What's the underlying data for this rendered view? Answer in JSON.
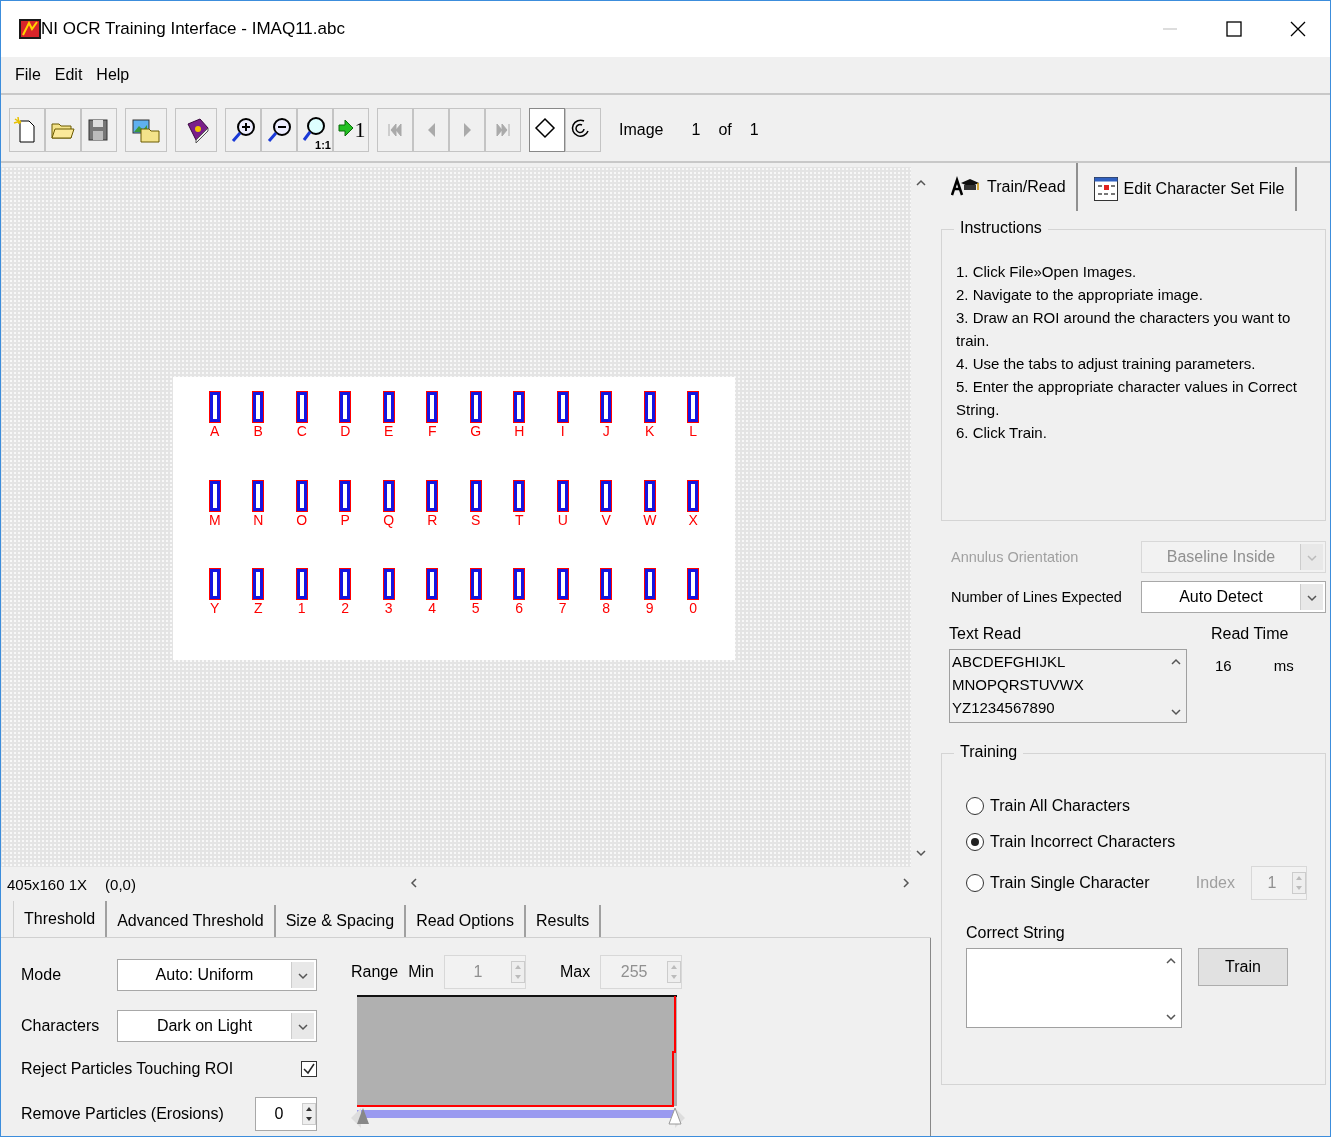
{
  "window": {
    "title": "NI OCR Training Interface - IMAQ11.abc"
  },
  "menu": [
    {
      "label": "File"
    },
    {
      "label": "Edit"
    },
    {
      "label": "Help"
    }
  ],
  "toolbar": {
    "groups": [
      [
        {
          "kind": "new"
        },
        {
          "kind": "open"
        },
        {
          "kind": "save"
        }
      ],
      [
        {
          "kind": "open-images"
        }
      ],
      [
        {
          "kind": "help"
        }
      ],
      [
        {
          "kind": "zoom-in"
        },
        {
          "kind": "zoom-out"
        },
        {
          "kind": "zoom-actual",
          "label": "1:1"
        },
        {
          "kind": "zoom-fit",
          "label": "1"
        }
      ],
      [
        {
          "kind": "first",
          "disabled": true
        },
        {
          "kind": "prev",
          "disabled": true
        },
        {
          "kind": "next",
          "disabled": true
        },
        {
          "kind": "last",
          "disabled": true
        }
      ],
      [
        {
          "kind": "rect-tool",
          "selected": true
        },
        {
          "kind": "annulus-tool",
          "selected": false
        }
      ]
    ],
    "image_label": "Image",
    "image_index": "1",
    "of_label": "of",
    "image_count": "1"
  },
  "image_view": {
    "rows": [
      [
        "A",
        "B",
        "C",
        "D",
        "E",
        "F",
        "G",
        "H",
        "I",
        "J",
        "K",
        "L"
      ],
      [
        "M",
        "N",
        "O",
        "P",
        "Q",
        "R",
        "S",
        "T",
        "U",
        "V",
        "W",
        "X"
      ],
      [
        "Y",
        "Z",
        "1",
        "2",
        "3",
        "4",
        "5",
        "6",
        "7",
        "8",
        "9",
        "0"
      ]
    ]
  },
  "status": {
    "size": "405x160 1X",
    "coords": "(0,0)"
  },
  "bottom_tabs": [
    {
      "label": "Threshold",
      "selected": true
    },
    {
      "label": "Advanced Threshold",
      "selected": false
    },
    {
      "label": "Size & Spacing",
      "selected": false
    },
    {
      "label": "Read Options",
      "selected": false
    },
    {
      "label": "Results",
      "selected": false
    }
  ],
  "threshold": {
    "mode": {
      "label": "Mode",
      "value": "Auto: Uniform"
    },
    "characters": {
      "label": "Characters",
      "value": "Dark on Light"
    },
    "reject": {
      "label": "Reject Particles Touching ROI",
      "checked": true
    },
    "erosions": {
      "label": "Remove Particles (Erosions)",
      "value": "0"
    },
    "range": {
      "label": "Range",
      "min_label": "Min",
      "min": "1",
      "max_label": "Max",
      "max": "255",
      "disabled": true
    }
  },
  "right_tabs": [
    {
      "label": "Train/Read",
      "kind": "train",
      "selected": true
    },
    {
      "label": "Edit Character Set File",
      "kind": "charset",
      "selected": false
    }
  ],
  "instructions": {
    "title": "Instructions",
    "items": [
      "1. Click File»Open Images.",
      "2. Navigate to the appropriate image.",
      "3. Draw an ROI around the characters you want to train.",
      "4. Use the tabs to adjust training parameters.",
      "5. Enter the appropriate character values in Correct String.",
      "6. Click Train."
    ]
  },
  "annulus": {
    "label": "Annulus Orientation",
    "value": "Baseline Inside",
    "disabled": true
  },
  "lines_expected": {
    "label": "Number of Lines Expected",
    "value": "Auto Detect",
    "disabled": false
  },
  "text_read": {
    "label": "Text Read",
    "lines": [
      "ABCDEFGHIJKL",
      "MNOPQRSTUVWX",
      "YZ1234567890"
    ]
  },
  "read_time": {
    "label": "Read Time",
    "value": "16",
    "unit": "ms"
  },
  "training": {
    "title": "Training",
    "options": [
      {
        "label": "Train All Characters",
        "selected": false
      },
      {
        "label": "Train Incorrect Characters",
        "selected": true
      },
      {
        "label": "Train Single Character",
        "selected": false
      }
    ],
    "index": {
      "label": "Index",
      "value": "1",
      "disabled": true
    },
    "correct_string": {
      "label": "Correct String"
    },
    "train_button": "Train"
  }
}
